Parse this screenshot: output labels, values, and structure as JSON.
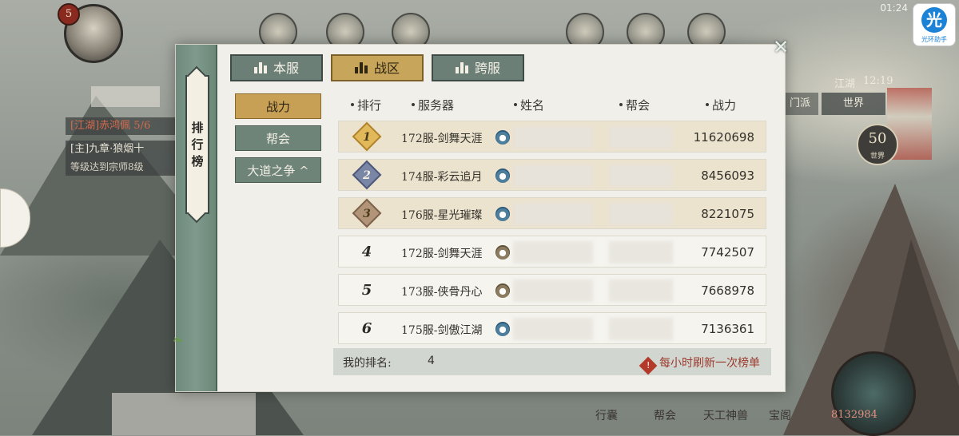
{
  "background": {
    "status_time": "01:24",
    "player_level": "5",
    "quest_lines": [
      {
        "tag": "[江湖]",
        "text": "赤鸿佩 5/6"
      },
      {
        "tag": "[主]",
        "text": "九章·狼烟十"
      },
      {
        "tag": "",
        "text": "等级达到宗师8级"
      }
    ],
    "map_time": "12:19",
    "map_region": "江湖",
    "world_tabs": {
      "sect": "门派",
      "world": "世界"
    },
    "world_level": "50",
    "world_level_sub": "世界",
    "bottom_menu": [
      "行囊",
      "帮会",
      "天工神兽",
      "宝阁"
    ],
    "player_power": "8132984",
    "app_logo": {
      "char": "光",
      "label": "光环助手"
    }
  },
  "panel": {
    "title": "排行榜",
    "tabs": [
      {
        "label": "本服",
        "active": false
      },
      {
        "label": "战区",
        "active": true
      },
      {
        "label": "跨服",
        "active": false
      }
    ],
    "categories": [
      {
        "label": "战力",
        "active": true
      },
      {
        "label": "帮会",
        "active": false
      },
      {
        "label": "大道之争 ^",
        "active": false
      }
    ],
    "headers": {
      "rank": "排行",
      "server": "服务器",
      "name": "姓名",
      "guild": "帮会",
      "power": "战力"
    },
    "rows": [
      {
        "rank": "1",
        "server": "172服-剑舞天涯",
        "power": "11620698"
      },
      {
        "rank": "2",
        "server": "174服-彩云追月",
        "power": "8456093"
      },
      {
        "rank": "3",
        "server": "176服-星光璀璨",
        "power": "8221075"
      },
      {
        "rank": "4",
        "server": "172服-剑舞天涯",
        "power": "7742507"
      },
      {
        "rank": "5",
        "server": "173服-侠骨丹心",
        "power": "7668978"
      },
      {
        "rank": "6",
        "server": "175服-剑傲江湖",
        "power": "7136361"
      }
    ],
    "my_rank_label": "我的排名:",
    "my_rank_value": "4",
    "refresh_note": "每小时刷新一次榜单",
    "refresh_icon": "!"
  }
}
